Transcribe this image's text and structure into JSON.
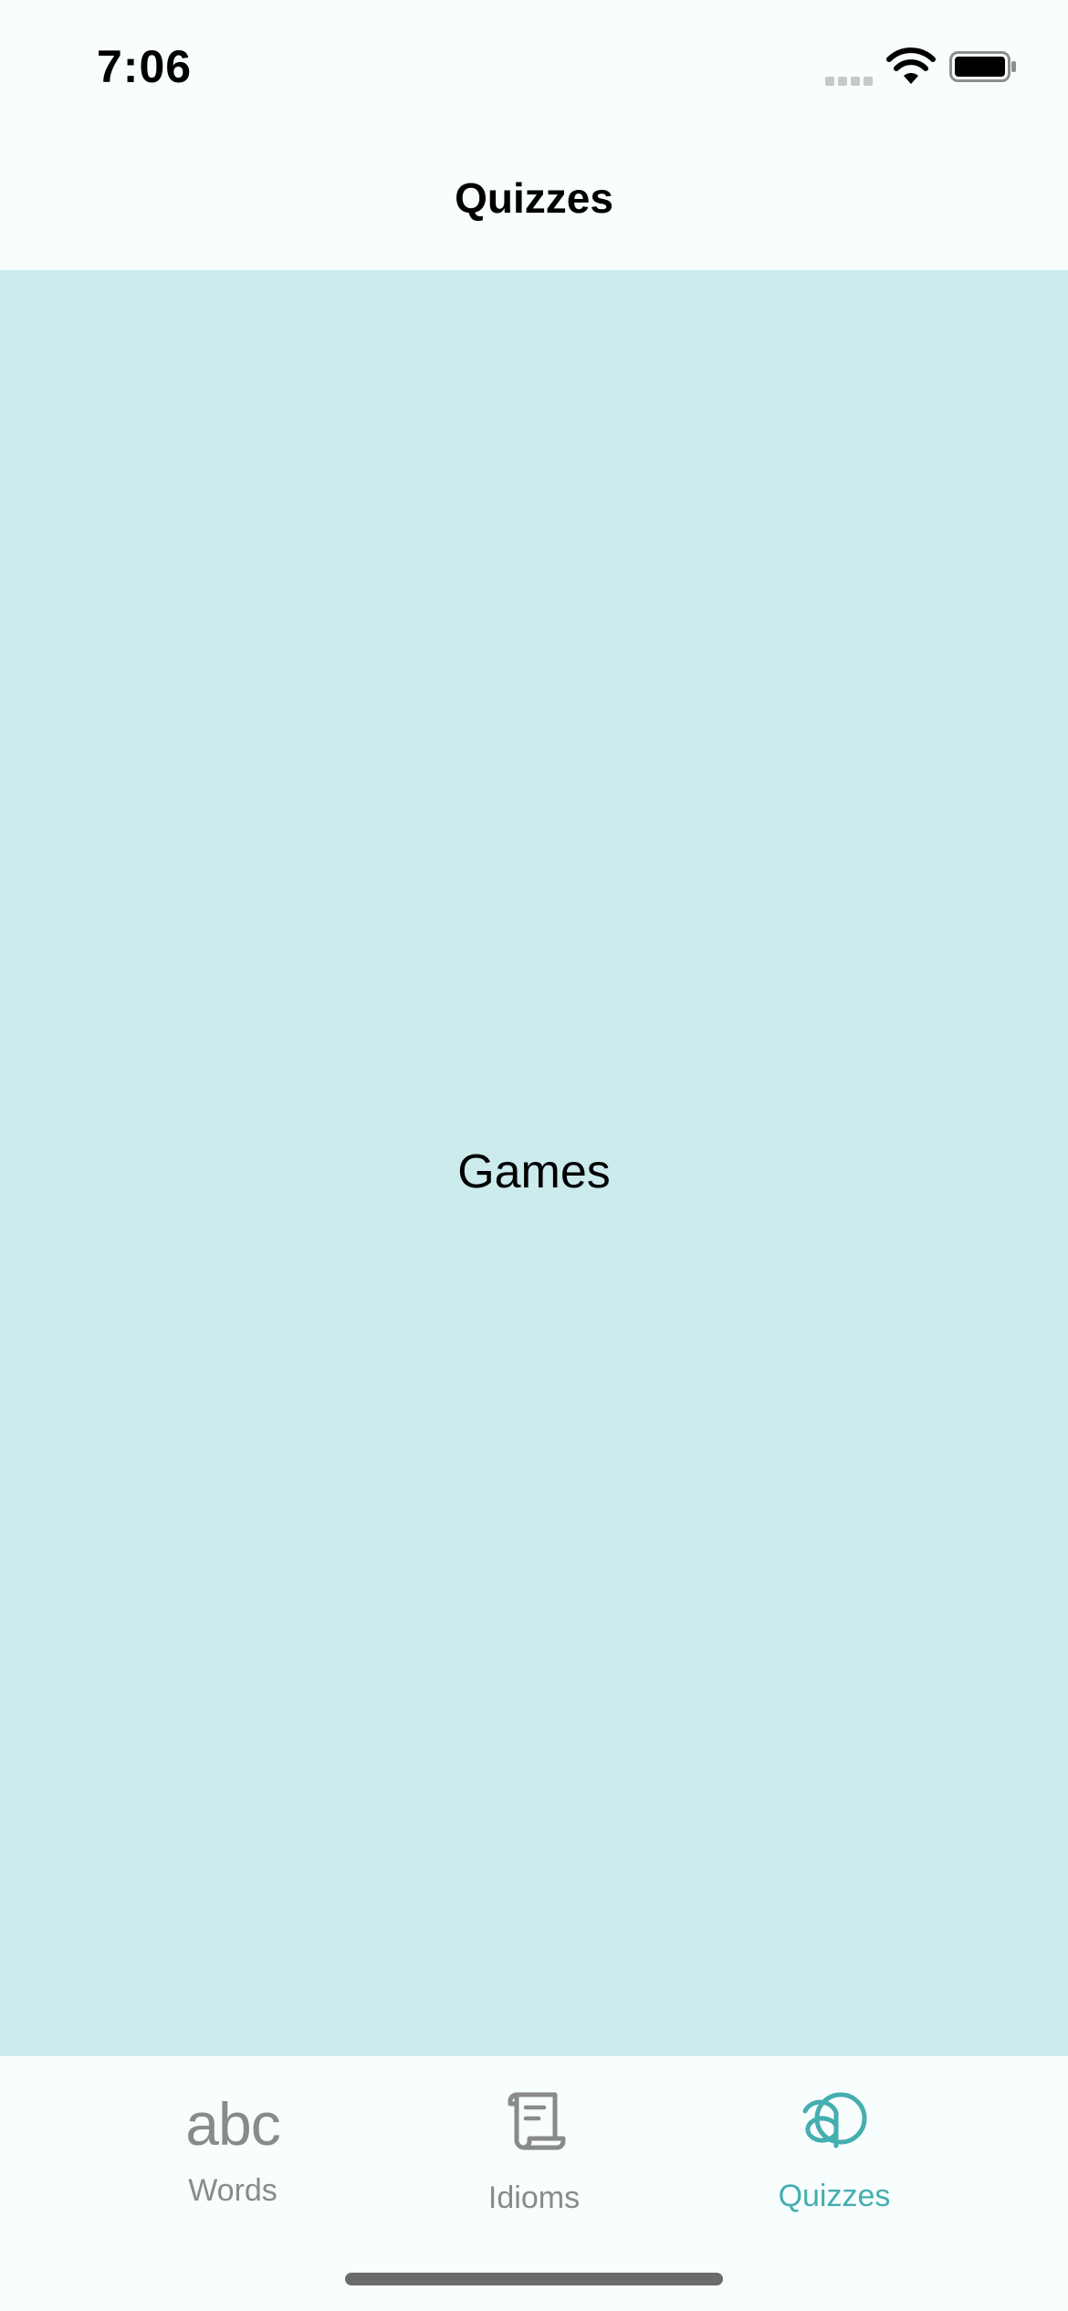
{
  "status_bar": {
    "time": "7:06"
  },
  "nav": {
    "title": "Quizzes"
  },
  "content": {
    "label": "Games"
  },
  "tabs": [
    {
      "label": "Words",
      "icon": "abc-icon",
      "icon_text": "abc",
      "active": false
    },
    {
      "label": "Idioms",
      "icon": "scroll-icon",
      "active": false
    },
    {
      "label": "Quizzes",
      "icon": "quiz-a-icon",
      "active": true
    }
  ],
  "colors": {
    "accent": "#45aeb0",
    "content_background": "#cbebec",
    "bar_background": "#f8fdfd",
    "inactive": "#8a8a8a"
  }
}
